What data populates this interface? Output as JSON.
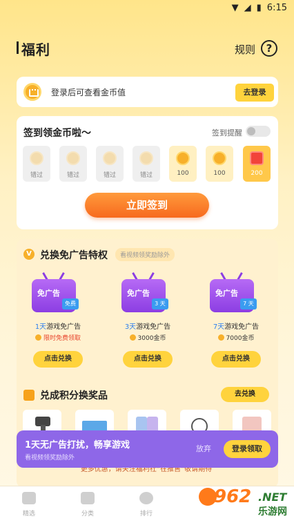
{
  "status_bar": {
    "time": "6:15"
  },
  "header": {
    "title": "福利",
    "rules_label": "规则",
    "help_label": "?"
  },
  "login_banner": {
    "text": "登录后可查看金币值",
    "button": "去登录"
  },
  "signin": {
    "title": "签到领金币啦～",
    "reminder_label": "签到提醒",
    "days": [
      {
        "label": "错过",
        "state": "missed"
      },
      {
        "label": "错过",
        "state": "missed"
      },
      {
        "label": "错过",
        "state": "missed"
      },
      {
        "label": "错过",
        "state": "missed"
      },
      {
        "label": "100",
        "state": "coin"
      },
      {
        "label": "100",
        "state": "coin"
      },
      {
        "label": "200",
        "state": "gift"
      }
    ],
    "button": "立即签到"
  },
  "ad_exchange": {
    "icon": "V",
    "title": "兑换免广告特权",
    "chip": "看视频领奖励除外",
    "items": [
      {
        "tv_text": "免广告",
        "tag": "免费",
        "day_num": "1天",
        "name_rest": "游戏免广告",
        "price": "限时免费领取",
        "price_color": "#E8452C",
        "button": "点击兑换"
      },
      {
        "tv_text": "免广告",
        "tag": "3 天",
        "day_num": "3天",
        "name_rest": "游戏免广告",
        "price": "3000金币",
        "price_color": "#333333",
        "button": "点击兑换"
      },
      {
        "tv_text": "免广告",
        "tag": "7 天",
        "day_num": "7天",
        "name_rest": "游戏免广告",
        "price": "7000金币",
        "price_color": "#333333",
        "button": "点击兑换"
      }
    ]
  },
  "points": {
    "title": "兑成积分换奖品",
    "button": "去兑换"
  },
  "promo_line": "更多优惠，请关注福利社“在推售”敬请期待",
  "toast": {
    "title": "1天无广告打扰，畅享游戏",
    "subtitle": "看视频领奖励除外",
    "dismiss": "放弃",
    "claim": "登录领取"
  },
  "bottom_nav": [
    {
      "label": "精选",
      "icon": "gamepad-icon"
    },
    {
      "label": "分类",
      "icon": "folder-icon"
    },
    {
      "label": "排行",
      "icon": "trophy-icon"
    }
  ],
  "watermark": {
    "number": "962",
    "net": ".NET",
    "cn": "乐游网"
  },
  "colors": {
    "accent": "#FFD33D",
    "signin_button": "#F76A1E",
    "toast_bg": "#8E67E8",
    "tv_purple": "#8C3EE3"
  }
}
